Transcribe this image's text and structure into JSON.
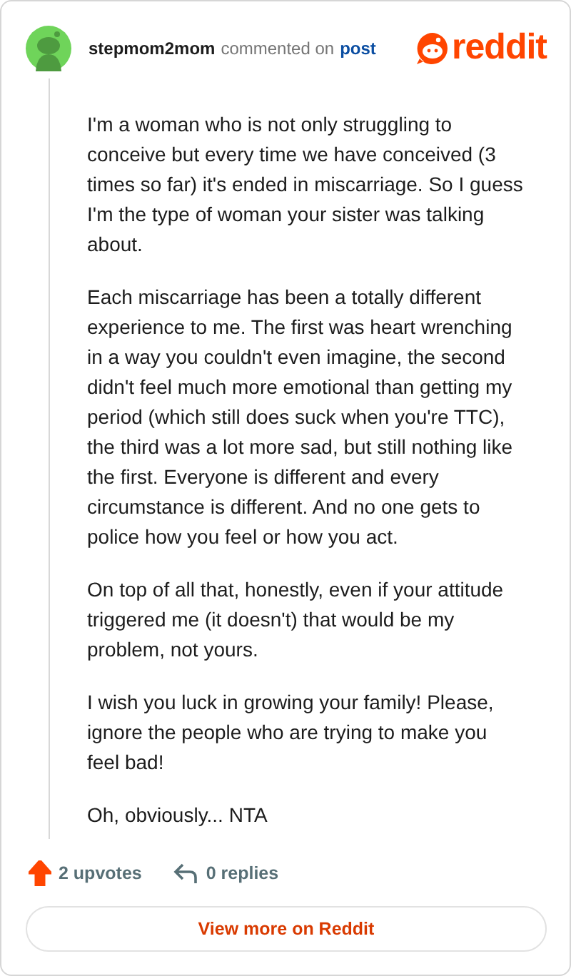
{
  "header": {
    "username": "stepmom2mom",
    "action": "commented on",
    "link": "post",
    "logo": "reddit"
  },
  "paragraphs": [
    "I'm a woman who is not only struggling to conceive but every time we have conceived (3 times so far) it's ended in miscarriage. So I guess I'm the type of woman your sister was talking about.",
    "Each miscarriage has been a totally different experience to me. The first was heart wrenching in a way you couldn't even imagine, the second didn't feel much more emotional than getting my period (which still does suck when you're TTC), the third was a lot more sad, but still nothing like the first. Everyone is different and every circumstance is different. And no one gets to police how you feel or how you act.",
    "On top of all that, honestly, even if your attitude triggered me (it doesn't) that would be my problem, not yours.",
    "I wish you luck in growing your family! Please, ignore the people who are trying to make you feel bad!",
    "Oh, obviously... NTA"
  ],
  "footer": {
    "upvotes": "2 upvotes",
    "upvoted": true,
    "replies": "0 replies",
    "button": "View more on Reddit"
  }
}
